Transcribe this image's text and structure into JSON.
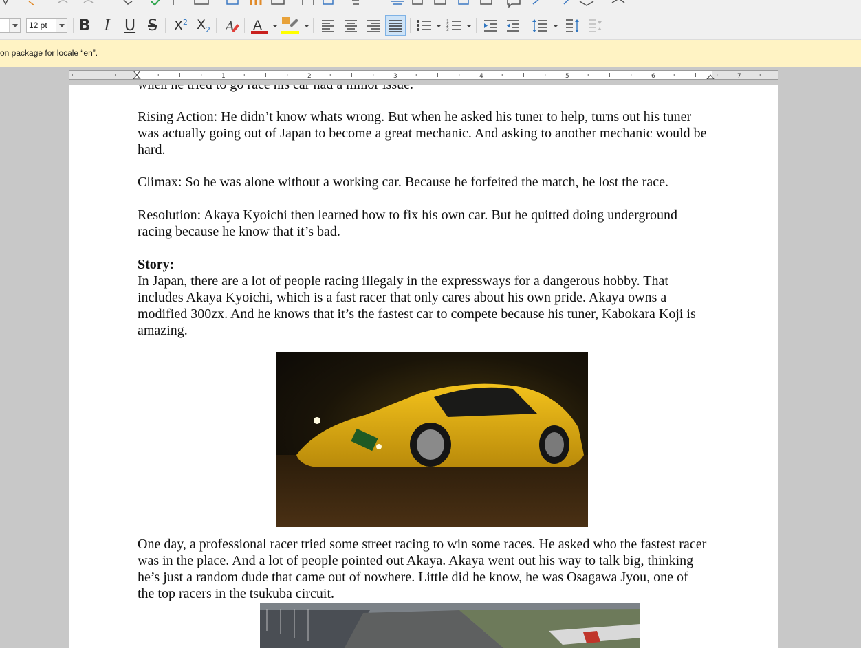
{
  "toolbar": {
    "font_size": "12pt",
    "font_size_label": "12 pt",
    "buttons": {
      "bold": "B",
      "italic": "I",
      "underline": "U",
      "strikethrough": "S",
      "superscript": "X²",
      "subscript": "X₂",
      "font_color_letter": "A"
    },
    "font_color": "#c9211e",
    "highlight_color": "#ffff00",
    "active_alignment": "justify"
  },
  "infobar": {
    "message": "on package for locale “en”."
  },
  "ruler": {
    "numbers": [
      "1",
      "2",
      "3",
      "4",
      "5",
      "6",
      "7"
    ]
  },
  "document": {
    "partial_line": "when he tried to go race his car had a minor issue.",
    "rising_action": "Rising Action: He didn’t know whats wrong. But when he asked his tuner to help, turns out his tuner was actually going out of Japan to become a great mechanic. And asking to another mechanic would be hard.",
    "climax": "Climax: So he was alone without a working car. Because he forfeited the match, he lost the race.",
    "resolution": "Resolution: Akaya Kyoichi then learned how to fix his own car. But he quitted doing underground racing because he know that it’s bad.",
    "story_heading": "Story:",
    "story_para1": "In Japan, there are a lot of people racing illegaly in the expressways for a dangerous hobby. That includes Akaya Kyoichi, which is a fast racer that only cares about his own pride. Akaya owns a modified 300zx. And he knows that it’s the fastest car to compete because his tuner, Kabokara Koji is amazing.",
    "story_para2": "One day, a professional racer tried some street racing to win some races. He asked who the fastest racer was in the place. And a lot of people pointed out Akaya. Akaya went out his way to talk big, thinking he’s just a random dude that came out of nowhere. Little did he know, he was Osagawa Jyou, one of the top racers in the tsukuba circuit."
  }
}
